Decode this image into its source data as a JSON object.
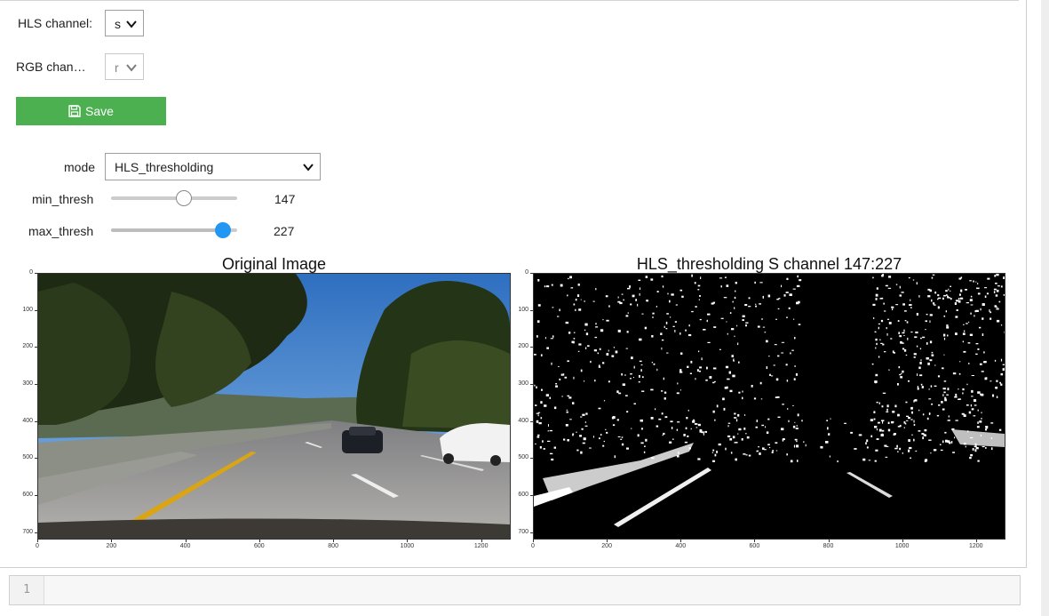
{
  "widgets": {
    "hls_channel": {
      "label": "HLS channel:",
      "value": "s"
    },
    "rgb_channel": {
      "label": "RGB chan…",
      "value": "r"
    },
    "save": {
      "label": "Save",
      "icon": "floppy-disk-icon",
      "color": "#4caf50"
    },
    "mode": {
      "label": "mode",
      "value": "HLS_thresholding"
    },
    "min_thresh": {
      "label": "min_thresh",
      "value": "147",
      "fraction": 0.58
    },
    "max_thresh": {
      "label": "max_thresh",
      "value": "227",
      "fraction": 0.89,
      "accent": "#2196f3"
    }
  },
  "figures": {
    "left": {
      "title": "Original Image",
      "yticks": [
        "0",
        "100",
        "200",
        "300",
        "400",
        "500",
        "600",
        "700"
      ],
      "xticks": [
        "0",
        "200",
        "400",
        "600",
        "800",
        "1000",
        "1200"
      ]
    },
    "right": {
      "title": "HLS_thresholding S channel 147:227",
      "yticks": [
        "0",
        "100",
        "200",
        "300",
        "400",
        "500",
        "600",
        "700"
      ],
      "xticks": [
        "0",
        "200",
        "400",
        "600",
        "800",
        "1000",
        "1200"
      ]
    }
  },
  "code_cell": {
    "line_number": "1",
    "content": ""
  }
}
